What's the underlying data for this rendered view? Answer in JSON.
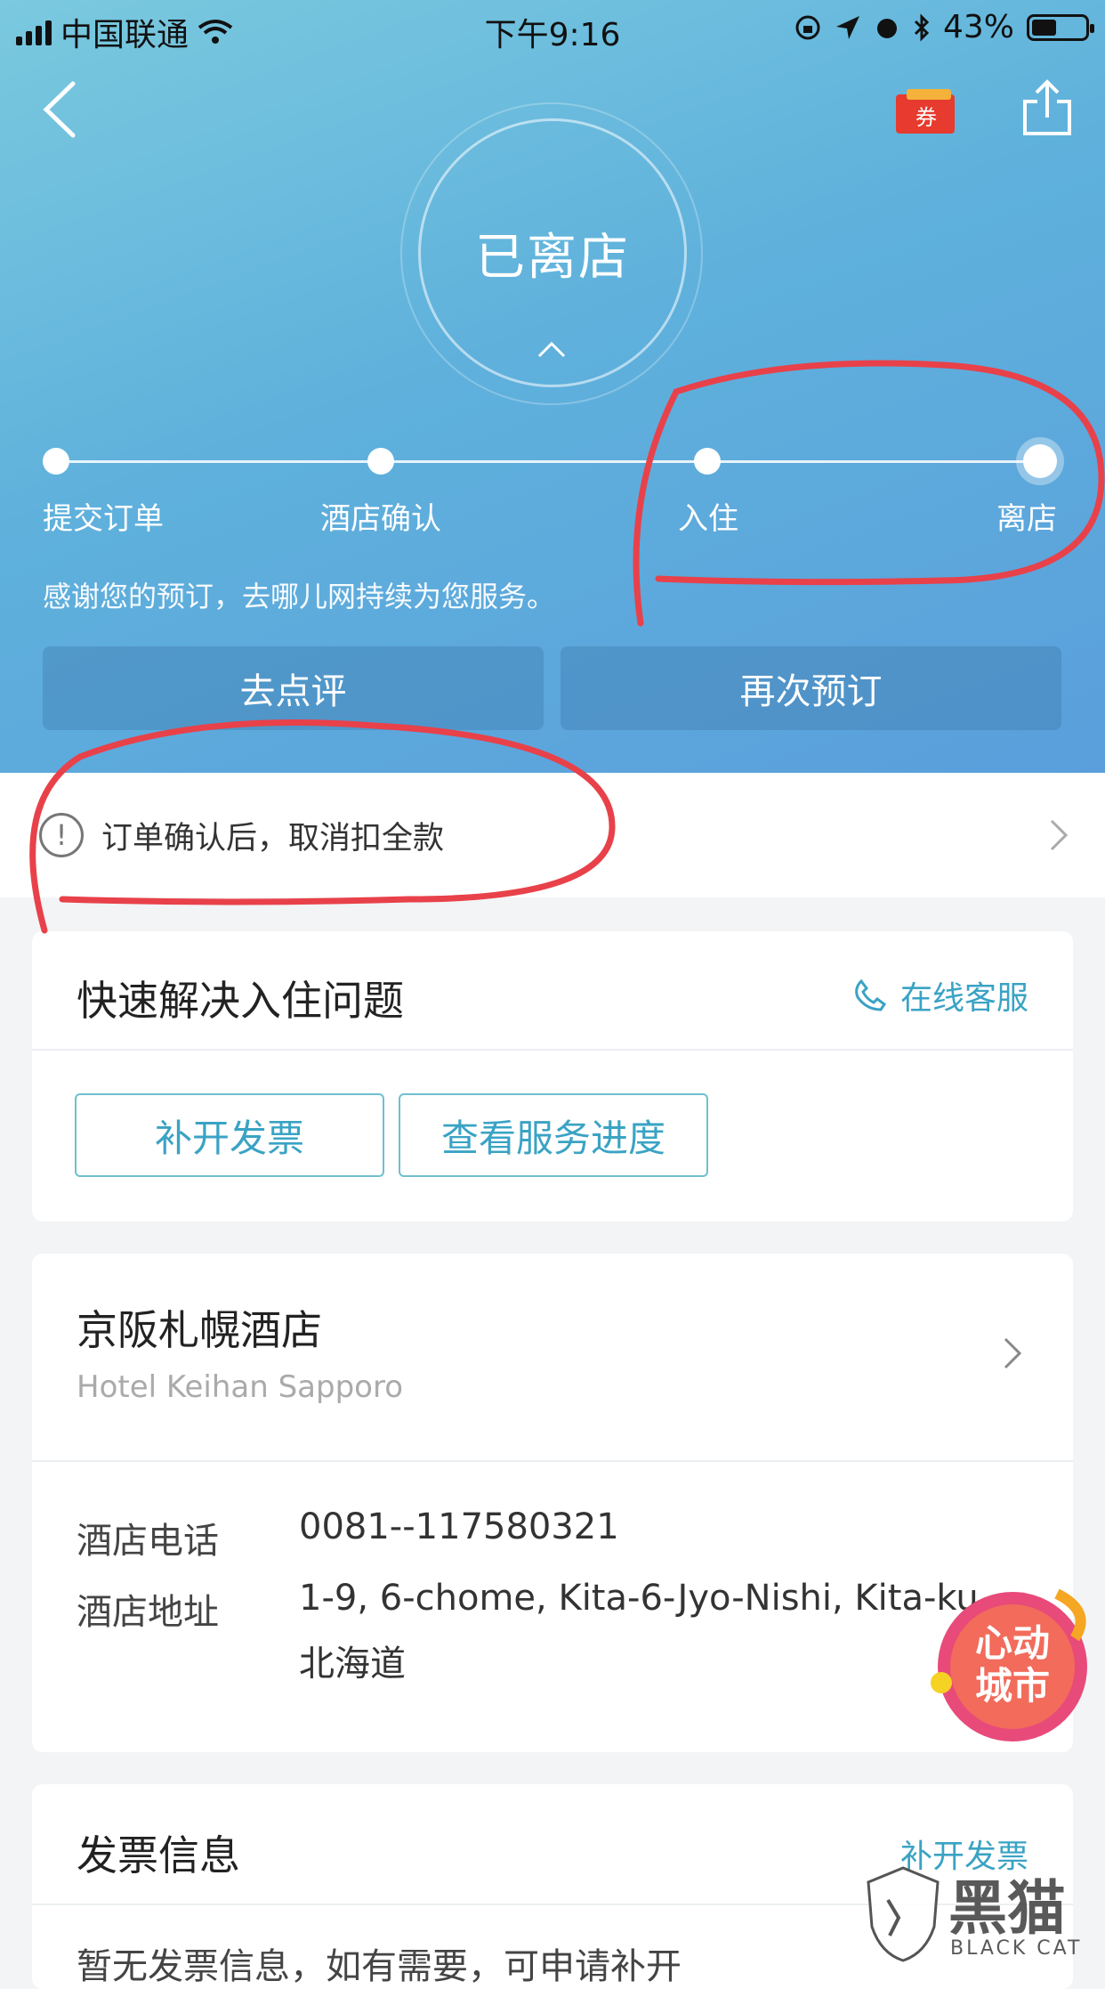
{
  "status_bar": {
    "carrier": "中国联通",
    "time": "下午9:16",
    "battery": "43%"
  },
  "header": {
    "back_icon": "chevron-left-icon",
    "coupon_label": "券",
    "share_icon": "share-icon"
  },
  "order_status": {
    "title": "已离店"
  },
  "progress": {
    "steps": [
      {
        "label": "提交订单"
      },
      {
        "label": "酒店确认"
      },
      {
        "label": "入住"
      },
      {
        "label": "离店"
      }
    ],
    "current_step_index": 3
  },
  "thanks_text": "感谢您的预订，去哪儿网持续为您服务。",
  "actions": {
    "review": "去点评",
    "rebook": "再次预订"
  },
  "notice": {
    "text": "订单确认后，取消扣全款"
  },
  "quick_help": {
    "title": "快速解决入住问题",
    "online_service": "在线客服",
    "buttons": [
      "补开发票",
      "查看服务进度"
    ]
  },
  "hotel": {
    "name_cn": "京阪札幌酒店",
    "name_en": "Hotel Keihan Sapporo",
    "phone_label": "酒店电话",
    "phone": "0081--117580321",
    "address_label": "酒店地址",
    "address_line1": "1-9, 6-chome, Kita-6-Jyo-Nishi, Kita-ku",
    "address_line2": "北海道"
  },
  "invoice": {
    "title": "发票信息",
    "action": "补开发票",
    "empty_text": "暂无发票信息，如有需要，可申请补开"
  },
  "overlays": {
    "promo_badge": "心动城市",
    "watermark": "黑猫",
    "watermark_en": "BLACK CAT"
  },
  "colors": {
    "accent": "#3aa3c4",
    "hero_top": "#7ac9df",
    "hero_bottom": "#5a9fdc",
    "annotation": "#e8414a"
  }
}
